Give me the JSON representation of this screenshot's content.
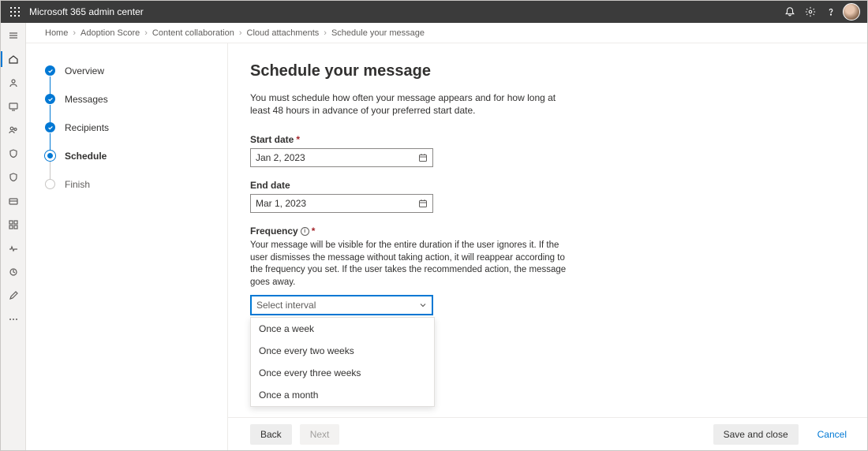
{
  "topbar": {
    "title": "Microsoft 365 admin center"
  },
  "breadcrumbs": {
    "items": [
      "Home",
      "Adoption Score",
      "Content collaboration",
      "Cloud attachments",
      "Schedule your message"
    ]
  },
  "wizard": {
    "steps": [
      {
        "label": "Overview",
        "state": "done"
      },
      {
        "label": "Messages",
        "state": "done"
      },
      {
        "label": "Recipients",
        "state": "done"
      },
      {
        "label": "Schedule",
        "state": "current"
      },
      {
        "label": "Finish",
        "state": "todo"
      }
    ]
  },
  "form": {
    "heading": "Schedule your message",
    "description": "You must schedule how often your message appears and for how long at least 48 hours in advance of your preferred start date.",
    "start_label": "Start date",
    "start_value": "Jan 2, 2023",
    "end_label": "End date",
    "end_value": "Mar 1, 2023",
    "frequency_label": "Frequency",
    "frequency_help": "Your message will be visible for the entire duration if the user ignores it. If the user dismisses the message without taking action, it will reappear according to the frequency you set. If the user takes the recommended action, the message goes away.",
    "frequency_placeholder": "Select interval",
    "frequency_options": [
      "Once a week",
      "Once every two weeks",
      "Once every three weeks",
      "Once a month"
    ]
  },
  "footer": {
    "back": "Back",
    "next": "Next",
    "save": "Save and close",
    "cancel": "Cancel"
  }
}
